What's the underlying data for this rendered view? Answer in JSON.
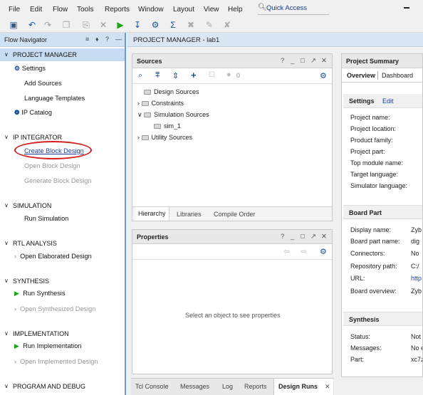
{
  "menu": [
    "File",
    "Edit",
    "Flow",
    "Tools",
    "Reports",
    "Window",
    "Layout",
    "View",
    "Help"
  ],
  "quick_access": "Quick Access",
  "flow_navigator": {
    "title": "Flow Navigator",
    "sections": [
      {
        "label": "PROJECT MANAGER",
        "items": [
          {
            "label": "Settings"
          },
          {
            "label": "Add Sources"
          },
          {
            "label": "Language Templates"
          },
          {
            "label": "IP Catalog"
          }
        ]
      },
      {
        "label": "IP INTEGRATOR",
        "items": [
          {
            "label": "Create Block Design"
          },
          {
            "label": "Open Block Design"
          },
          {
            "label": "Generate Block Design"
          }
        ]
      },
      {
        "label": "SIMULATION",
        "items": [
          {
            "label": "Run Simulation"
          }
        ]
      },
      {
        "label": "RTL ANALYSIS",
        "items": [
          {
            "label": "Open Elaborated Design"
          }
        ]
      },
      {
        "label": "SYNTHESIS",
        "items": [
          {
            "label": "Run Synthesis"
          },
          {
            "label": "Open Synthesized Design"
          }
        ]
      },
      {
        "label": "IMPLEMENTATION",
        "items": [
          {
            "label": "Run Implementation"
          },
          {
            "label": "Open Implemented Design"
          }
        ]
      },
      {
        "label": "PROGRAM AND DEBUG",
        "items": []
      }
    ]
  },
  "project_manager_title": "PROJECT MANAGER - lab1",
  "sources": {
    "title": "Sources",
    "count": "0",
    "tree": [
      "Design Sources",
      "Constraints",
      "Simulation Sources",
      "sim_1",
      "Utility Sources"
    ],
    "tabs": [
      "Hierarchy",
      "Libraries",
      "Compile Order"
    ]
  },
  "properties": {
    "title": "Properties",
    "empty_message": "Select an object to see properties"
  },
  "summary": {
    "title": "Project Summary",
    "tabs": [
      "Overview",
      "Dashboard"
    ],
    "settings_title": "Settings",
    "edit": "Edit",
    "settings_rows": [
      "Project name:",
      "Project location:",
      "Product family:",
      "Project part:",
      "Top module name:",
      "Target language:",
      "Simulator language:"
    ],
    "board_title": "Board Part",
    "board_rows": [
      "Display name:",
      "Board part name:",
      "Connectors:",
      "Repository path:",
      "URL:",
      "Board overview:"
    ],
    "board_values": [
      "Zyb",
      "dig",
      "No",
      "C:/",
      "http",
      "Zyb"
    ],
    "synthesis_title": "Synthesis",
    "synth_rows": [
      "Status:",
      "Messages:",
      "Part:"
    ],
    "synth_values": [
      "Not s",
      "No e",
      "xc7z"
    ]
  },
  "bottom_tabs": [
    "Tcl Console",
    "Messages",
    "Log",
    "Reports",
    "Design Runs"
  ]
}
